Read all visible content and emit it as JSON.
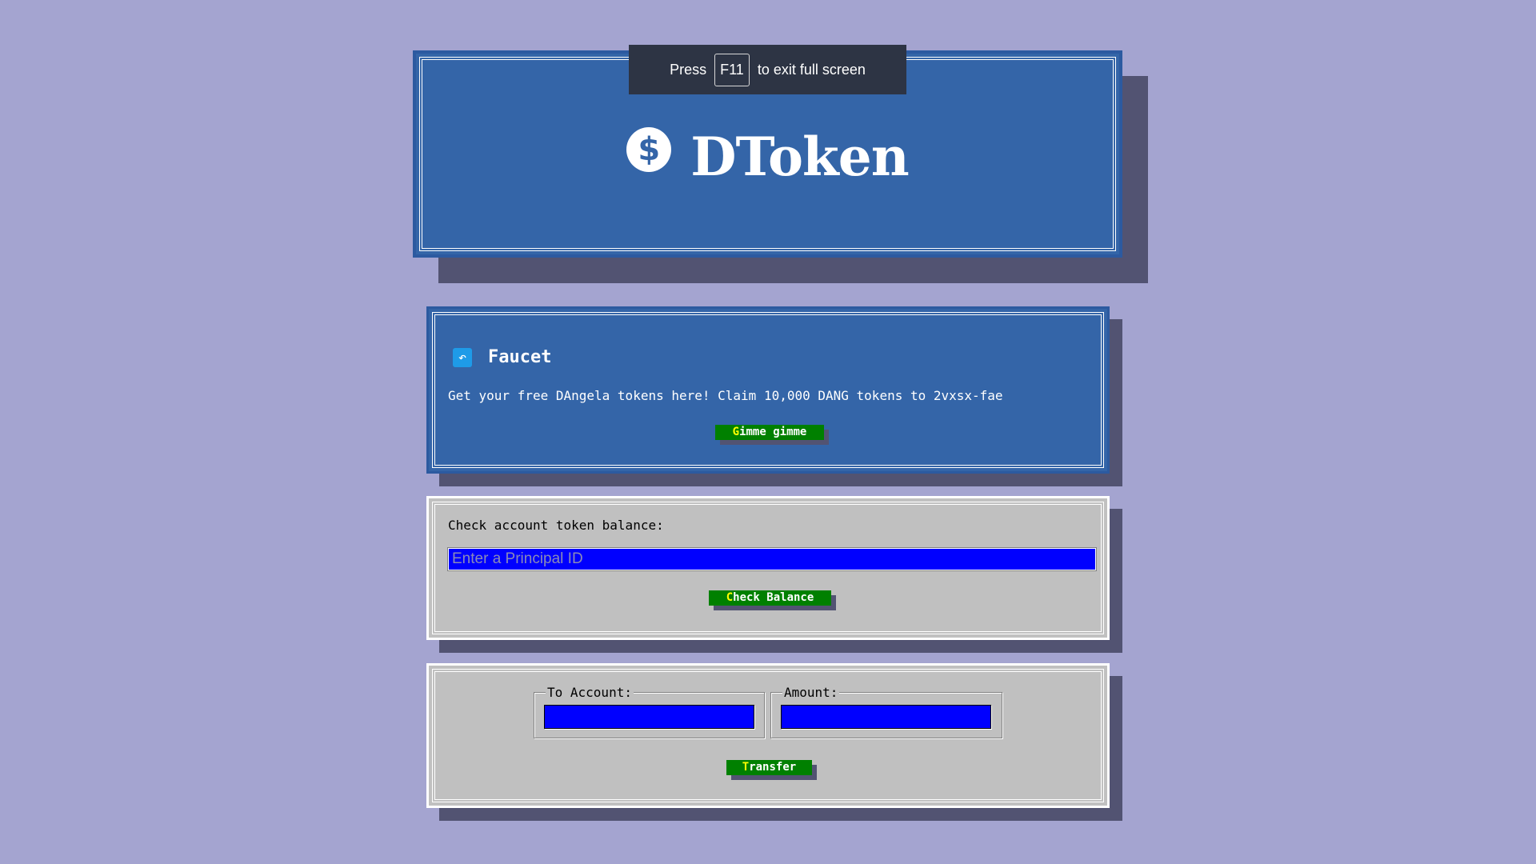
{
  "header": {
    "icon": "dollar-circle-icon",
    "title": "DToken"
  },
  "fullscreen_toast": {
    "prefix": "Press",
    "key": "F11",
    "suffix": "to exit full screen"
  },
  "faucet": {
    "icon": "faucet-icon",
    "title": "Faucet",
    "description": "Get your free DAngela tokens here! Claim 10,000 DANG tokens to 2vxsx-fae",
    "button_hotkey": "G",
    "button_rest": "imme gimme"
  },
  "balance": {
    "label": "Check account token balance:",
    "placeholder": "Enter a Principal ID",
    "value": "",
    "button_hotkey": "C",
    "button_rest": "heck Balance"
  },
  "transfer": {
    "to_account_label": "To Account:",
    "to_account_value": "",
    "amount_label": "Amount:",
    "amount_value": "",
    "button_hotkey": "T",
    "button_rest": "ransfer"
  },
  "colors": {
    "background": "#a4a4d0",
    "panel_blue": "#3465a8",
    "panel_gray": "#c0c0c0",
    "button_green": "#008000",
    "input_blue": "#0000ff",
    "shadow": "#525372",
    "hotkey_yellow": "#ffff00"
  }
}
